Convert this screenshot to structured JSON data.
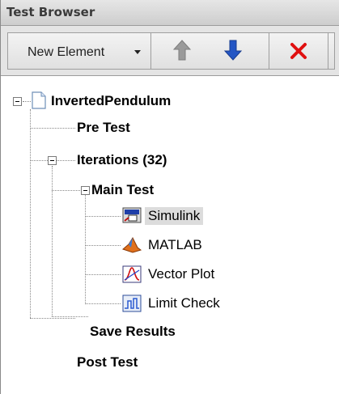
{
  "panel": {
    "title": "Test Browser"
  },
  "toolbar": {
    "new_element_label": "New Element",
    "icons": {
      "move_up": "up-arrow-icon",
      "move_down": "down-arrow-icon",
      "delete": "delete-x-icon"
    },
    "colors": {
      "up_arrow": "#9a9a9a",
      "down_arrow": "#2456c4",
      "delete": "#e01010"
    }
  },
  "tree": {
    "root": {
      "label": "InvertedPendulum",
      "icon": "document-icon",
      "expanded": true
    },
    "pre_test": {
      "label": "Pre Test"
    },
    "iterations": {
      "label": "Iterations  (32)",
      "expanded": true
    },
    "main_test": {
      "label": "Main Test",
      "expanded": true
    },
    "steps": [
      {
        "label": "Simulink",
        "icon": "simulink-icon",
        "selected": true
      },
      {
        "label": "MATLAB",
        "icon": "matlab-icon",
        "selected": false
      },
      {
        "label": "Vector Plot",
        "icon": "vector-plot-icon",
        "selected": false
      },
      {
        "label": "Limit Check",
        "icon": "limit-check-icon",
        "selected": false
      }
    ],
    "save_results": {
      "label": "Save Results"
    },
    "post_test": {
      "label": "Post Test"
    }
  }
}
